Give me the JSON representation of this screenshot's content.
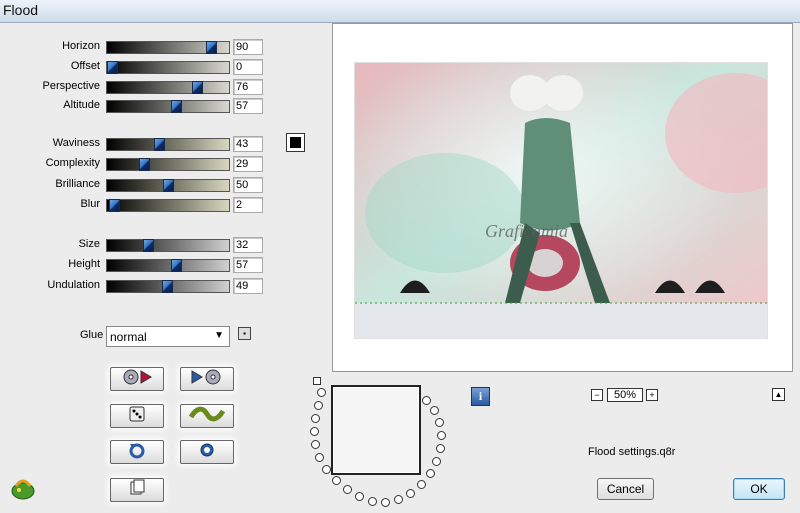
{
  "window": {
    "title": "Flood"
  },
  "sliders_group1": [
    {
      "label": "Horizon",
      "value": "90",
      "level": 90
    },
    {
      "label": "Offset",
      "value": "0",
      "level": 0
    },
    {
      "label": "Perspective",
      "value": "76",
      "level": 76
    },
    {
      "label": "Altitude",
      "value": "57",
      "level": 57
    }
  ],
  "sliders_group2": [
    {
      "label": "Waviness",
      "value": "43",
      "level": 43
    },
    {
      "label": "Complexity",
      "value": "29",
      "level": 29
    },
    {
      "label": "Brilliance",
      "value": "50",
      "level": 50
    },
    {
      "label": "Blur",
      "value": "2",
      "level": 2
    }
  ],
  "sliders_group3": [
    {
      "label": "Size",
      "value": "32",
      "level": 32
    },
    {
      "label": "Height",
      "value": "57",
      "level": 57
    },
    {
      "label": "Undulation",
      "value": "49",
      "level": 49
    }
  ],
  "glue": {
    "label": "Glue",
    "selected": "normal"
  },
  "preview": {
    "watermark": "Graficamia"
  },
  "zoom": {
    "minus": "−",
    "value": "50%",
    "plus": "+"
  },
  "info": {
    "glyph": "i"
  },
  "settings": {
    "filename": "Flood settings.q8r"
  },
  "buttons": {
    "cancel": "Cancel",
    "ok": "OK"
  },
  "colors": {
    "accent": "#3a78c4",
    "title_bg": "#dfe7f2",
    "ok_border": "#3c7fb1"
  },
  "icons": {
    "load_preset": "disk-play-icon",
    "save_preset": "play-disk-icon",
    "random": "dice-icon",
    "reset": "wave-icon",
    "undo": "undo-icon",
    "redo": "redo-icon",
    "copy": "copy-icon",
    "logo": "filter-plugin-logo-icon"
  }
}
